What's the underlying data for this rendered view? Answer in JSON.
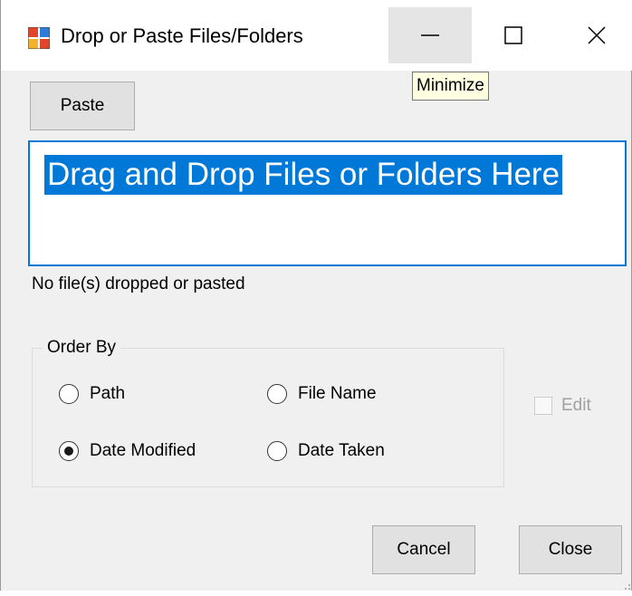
{
  "window": {
    "title": "Drop or Paste Files/Folders",
    "icon": "app-window-icon",
    "controls": {
      "minimize_icon": "minimize-icon",
      "maximize_icon": "maximize-icon",
      "close_icon": "close-icon"
    },
    "tooltip": "Minimize"
  },
  "paste_button": {
    "label": "Paste"
  },
  "drop_area": {
    "text": "Drag and Drop Files or Folders Here"
  },
  "status": {
    "text": "No file(s) dropped or pasted"
  },
  "order_by": {
    "legend": "Order By",
    "options": [
      {
        "label": "Path",
        "checked": false
      },
      {
        "label": "File Name",
        "checked": false
      },
      {
        "label": "Date Modified",
        "checked": true
      },
      {
        "label": "Date Taken",
        "checked": false
      }
    ],
    "selected": "Date Modified"
  },
  "edit_checkbox": {
    "label": "Edit",
    "checked": false,
    "enabled": false
  },
  "buttons": {
    "cancel": "Cancel",
    "close": "Close"
  },
  "colors": {
    "accent": "#0078d7",
    "window_bg": "#f0f0f0",
    "tooltip_bg": "#ffffe1",
    "button_bg": "#e1e1e1"
  }
}
